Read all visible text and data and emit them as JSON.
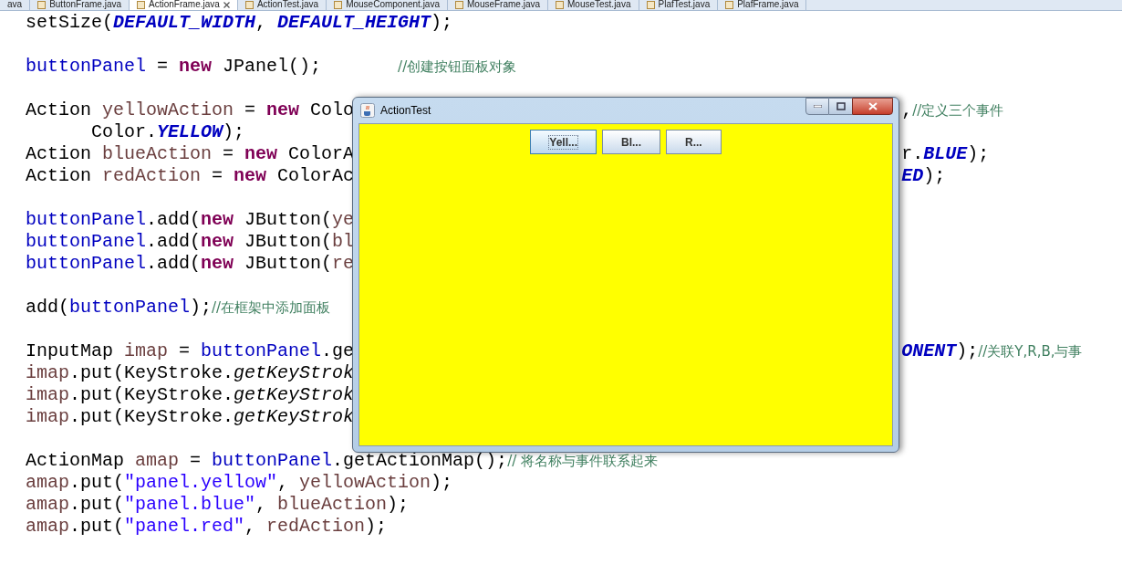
{
  "editor_tabs": [
    {
      "label": "ava",
      "selected": false,
      "closable": false
    },
    {
      "label": "ButtonFrame.java",
      "selected": false,
      "closable": false
    },
    {
      "label": "ActionFrame.java",
      "selected": true,
      "closable": true
    },
    {
      "label": "ActionTest.java",
      "selected": false,
      "closable": false
    },
    {
      "label": "MouseComponent.java",
      "selected": false,
      "closable": false
    },
    {
      "label": "MouseFrame.java",
      "selected": false,
      "closable": false
    },
    {
      "label": "MouseTest.java",
      "selected": false,
      "closable": false
    },
    {
      "label": "PlafTest.java",
      "selected": false,
      "closable": false
    },
    {
      "label": "PlafFrame.java",
      "selected": false,
      "closable": false
    }
  ],
  "code_blocks": [
    [
      {
        "left": [
          {
            "kind": "plain",
            "text": "setSize("
          },
          {
            "kind": "const",
            "text": "DEFAULT_WIDTH"
          },
          {
            "kind": "plain",
            "text": ", "
          },
          {
            "kind": "const",
            "text": "DEFAULT_HEIGHT"
          },
          {
            "kind": "plain",
            "text": ");"
          }
        ]
      }
    ],
    [
      {
        "left": [
          {
            "kind": "field",
            "text": "buttonPanel"
          },
          {
            "kind": "plain",
            "text": " = "
          },
          {
            "kind": "keyword",
            "text": "new"
          },
          {
            "kind": "plain",
            "text": " JPanel();       "
          },
          {
            "kind": "comment",
            "text": "//创建按钮面板对象"
          }
        ]
      }
    ],
    [
      {
        "left": [
          {
            "kind": "plain",
            "text": "Action "
          },
          {
            "kind": "local",
            "text": "yellowAction"
          },
          {
            "kind": "plain",
            "text": " = "
          },
          {
            "kind": "keyword",
            "text": "new"
          },
          {
            "kind": "plain",
            "text": " Colo"
          }
        ],
        "right": [
          {
            "kind": "plain",
            "text": ","
          },
          {
            "kind": "comment",
            "text": "//定义三个事件"
          }
        ]
      },
      {
        "left": [
          {
            "kind": "plain",
            "text": "      Color."
          },
          {
            "kind": "const",
            "text": "YELLOW"
          },
          {
            "kind": "plain",
            "text": ");"
          }
        ]
      },
      {
        "left": [
          {
            "kind": "plain",
            "text": "Action "
          },
          {
            "kind": "local",
            "text": "blueAction"
          },
          {
            "kind": "plain",
            "text": " = "
          },
          {
            "kind": "keyword",
            "text": "new"
          },
          {
            "kind": "plain",
            "text": " ColorA"
          }
        ],
        "right": [
          {
            "kind": "plain",
            "text": "r."
          },
          {
            "kind": "const",
            "text": "BLUE"
          },
          {
            "kind": "plain",
            "text": ");"
          }
        ]
      },
      {
        "left": [
          {
            "kind": "plain",
            "text": "Action "
          },
          {
            "kind": "local",
            "text": "redAction"
          },
          {
            "kind": "plain",
            "text": " = "
          },
          {
            "kind": "keyword",
            "text": "new"
          },
          {
            "kind": "plain",
            "text": " ColorAc"
          }
        ],
        "right": [
          {
            "kind": "const",
            "text": "ED"
          },
          {
            "kind": "plain",
            "text": ");"
          }
        ]
      }
    ],
    [
      {
        "left": [
          {
            "kind": "field",
            "text": "buttonPanel"
          },
          {
            "kind": "plain",
            "text": ".add("
          },
          {
            "kind": "keyword",
            "text": "new"
          },
          {
            "kind": "plain",
            "text": " JButton("
          },
          {
            "kind": "local",
            "text": "ye"
          }
        ]
      },
      {
        "left": [
          {
            "kind": "field",
            "text": "buttonPanel"
          },
          {
            "kind": "plain",
            "text": ".add("
          },
          {
            "kind": "keyword",
            "text": "new"
          },
          {
            "kind": "plain",
            "text": " JButton("
          },
          {
            "kind": "local",
            "text": "bl"
          }
        ]
      },
      {
        "left": [
          {
            "kind": "field",
            "text": "buttonPanel"
          },
          {
            "kind": "plain",
            "text": ".add("
          },
          {
            "kind": "keyword",
            "text": "new"
          },
          {
            "kind": "plain",
            "text": " JButton("
          },
          {
            "kind": "local",
            "text": "re"
          }
        ]
      }
    ],
    [
      {
        "left": [
          {
            "kind": "plain",
            "text": "add("
          },
          {
            "kind": "field",
            "text": "buttonPanel"
          },
          {
            "kind": "plain",
            "text": ");"
          },
          {
            "kind": "comment",
            "text": "//在框架中添加面板"
          }
        ]
      }
    ],
    [
      {
        "left": [
          {
            "kind": "plain",
            "text": "InputMap "
          },
          {
            "kind": "local",
            "text": "imap"
          },
          {
            "kind": "plain",
            "text": " = "
          },
          {
            "kind": "field",
            "text": "buttonPanel"
          },
          {
            "kind": "plain",
            "text": ".ge"
          }
        ],
        "right": [
          {
            "kind": "const",
            "text": "ONENT"
          },
          {
            "kind": "plain",
            "text": ");"
          },
          {
            "kind": "comment",
            "text": "//关联Y,R,B,与事"
          }
        ]
      },
      {
        "left": [
          {
            "kind": "local",
            "text": "imap"
          },
          {
            "kind": "plain",
            "text": ".put(KeyStroke."
          },
          {
            "kind": "static",
            "text": "getKeyStrok"
          }
        ]
      },
      {
        "left": [
          {
            "kind": "local",
            "text": "imap"
          },
          {
            "kind": "plain",
            "text": ".put(KeyStroke."
          },
          {
            "kind": "static",
            "text": "getKeyStrok"
          }
        ]
      },
      {
        "left": [
          {
            "kind": "local",
            "text": "imap"
          },
          {
            "kind": "plain",
            "text": ".put(KeyStroke."
          },
          {
            "kind": "static",
            "text": "getKeyStrok"
          }
        ]
      }
    ],
    [
      {
        "left": [
          {
            "kind": "plain",
            "text": "ActionMap "
          },
          {
            "kind": "local",
            "text": "amap"
          },
          {
            "kind": "plain",
            "text": " = "
          },
          {
            "kind": "field",
            "text": "buttonPanel"
          },
          {
            "kind": "plain",
            "text": ".getActionMap();"
          },
          {
            "kind": "comment",
            "text": "// 将名称与事件联系起来"
          }
        ]
      },
      {
        "left": [
          {
            "kind": "local",
            "text": "amap"
          },
          {
            "kind": "plain",
            "text": ".put("
          },
          {
            "kind": "string",
            "text": "\"panel.yellow\""
          },
          {
            "kind": "plain",
            "text": ", "
          },
          {
            "kind": "local",
            "text": "yellowAction"
          },
          {
            "kind": "plain",
            "text": ");"
          }
        ]
      },
      {
        "left": [
          {
            "kind": "local",
            "text": "amap"
          },
          {
            "kind": "plain",
            "text": ".put("
          },
          {
            "kind": "string",
            "text": "\"panel.blue\""
          },
          {
            "kind": "plain",
            "text": ", "
          },
          {
            "kind": "local",
            "text": "blueAction"
          },
          {
            "kind": "plain",
            "text": ");"
          }
        ]
      },
      {
        "left": [
          {
            "kind": "local",
            "text": "amap"
          },
          {
            "kind": "plain",
            "text": ".put("
          },
          {
            "kind": "string",
            "text": "\"panel.red\""
          },
          {
            "kind": "plain",
            "text": ", "
          },
          {
            "kind": "local",
            "text": "redAction"
          },
          {
            "kind": "plain",
            "text": ");"
          }
        ]
      }
    ]
  ],
  "window": {
    "title": "ActionTest",
    "buttons": [
      {
        "label": "Yell...",
        "focused": true
      },
      {
        "label": "Bl...",
        "focused": false
      },
      {
        "label": "R...",
        "focused": false
      }
    ]
  }
}
